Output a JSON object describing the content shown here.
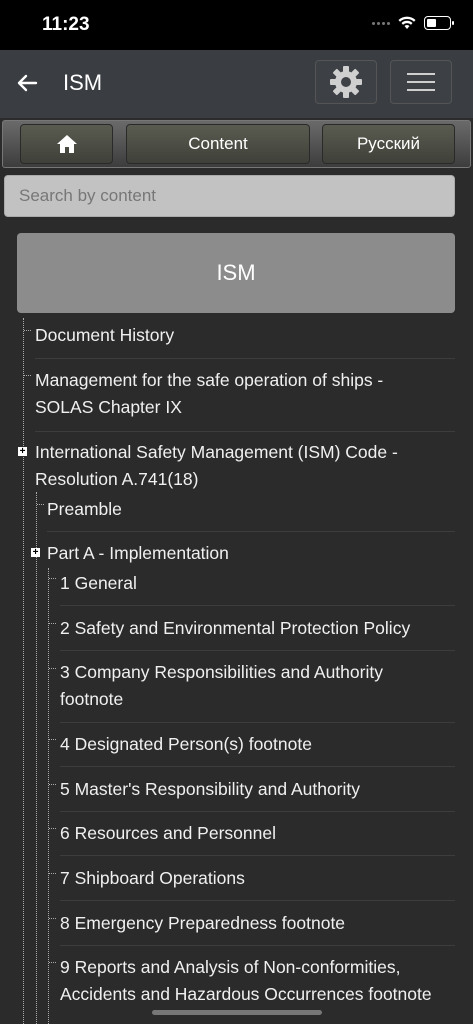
{
  "status": {
    "time": "11:23"
  },
  "header": {
    "title": "ISM"
  },
  "toolbar": {
    "content_label": "Content",
    "language_label": "Русский"
  },
  "search": {
    "placeholder": "Search by content"
  },
  "document": {
    "title": "ISM"
  },
  "tree": {
    "items": [
      {
        "label": "Document History"
      },
      {
        "label": "Management for the safe operation of ships - SOLAS Chapter IX"
      },
      {
        "label": "International Safety Management (ISM) Code - Resolution A.741(18)"
      },
      {
        "label": "Preamble"
      },
      {
        "label": "Part A - Implementation"
      },
      {
        "label": "1 General"
      },
      {
        "label": "2 Safety and Environmental Protection Policy"
      },
      {
        "label": "3 Company Responsibilities and Authority footnote"
      },
      {
        "label": "4 Designated Person(s) footnote"
      },
      {
        "label": "5 Master's Responsibility and Authority"
      },
      {
        "label": "6 Resources and Personnel"
      },
      {
        "label": "7 Shipboard Operations"
      },
      {
        "label": "8 Emergency Preparedness footnote"
      },
      {
        "label": "9 Reports and Analysis of Non-conformities, Accidents and Hazardous Occurrences footnote"
      }
    ]
  },
  "icons": {
    "back": "back-arrow-icon",
    "settings": "gear-icon",
    "menu": "hamburger-icon",
    "home": "home-icon",
    "expand": "plus-icon"
  }
}
